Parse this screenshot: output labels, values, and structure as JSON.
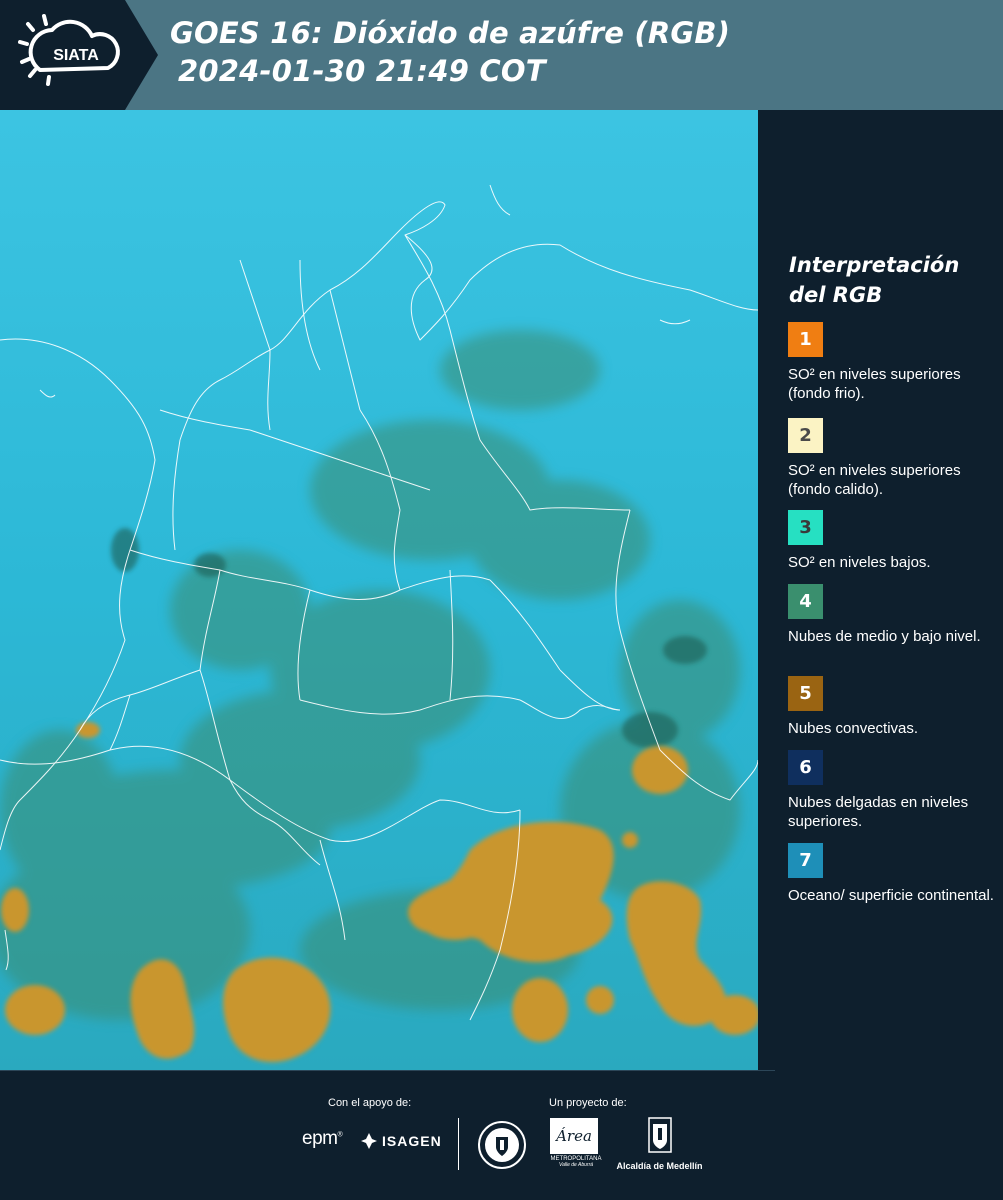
{
  "header": {
    "title": "GOES 16: Dióxido de azúfre (RGB)",
    "timestamp": "2024-01-30 21:49 COT",
    "logo_text": "SIATA",
    "background_color": "#4b7584",
    "logo_background_color": "#0e1f2d"
  },
  "map": {
    "background_color": "#2cb8d6",
    "border_color": "#ffffff",
    "convective_cloud_color": "#c9962e",
    "low_cloud_color": "#3b8d72"
  },
  "legend": {
    "title_line1": "Interpretación",
    "title_line2": "del RGB",
    "items": [
      {
        "number": "1",
        "label": "SO² en niveles superiores (fondo frio).",
        "color": "#f07e12",
        "number_color": "#ffffff"
      },
      {
        "number": "2",
        "label": "SO² en niveles superiores (fondo calido).",
        "color": "#fbf3c4",
        "number_color": "#4a4a4a"
      },
      {
        "number": "3",
        "label": "SO² en niveles bajos.",
        "color": "#26e0c2",
        "number_color": "#3a3a3a"
      },
      {
        "number": "4",
        "label": "Nubes de medio y bajo nivel.",
        "color": "#3a8f6e",
        "number_color": "#ffffff"
      },
      {
        "number": "5",
        "label": "Nubes convectivas.",
        "color": "#9a6412",
        "number_color": "#ffffff"
      },
      {
        "number": "6",
        "label": "Nubes delgadas en niveles superiores.",
        "color": "#0f2f5e",
        "number_color": "#ffffff"
      },
      {
        "number": "7",
        "label": "Oceano/ superficie continental.",
        "color": "#1e8fb8",
        "number_color": "#ffffff"
      }
    ]
  },
  "footer": {
    "support_label": "Con el apoyo de:",
    "project_label": "Un proyecto de:",
    "sponsor_epm": "epm",
    "sponsor_isagen": "ISAGEN",
    "area_text": "Área",
    "area_subtitle": "METROPOLITANA",
    "area_subtitle2": "Valle de Aburrá",
    "alcaldia_text": "Alcaldía de Medellín"
  }
}
